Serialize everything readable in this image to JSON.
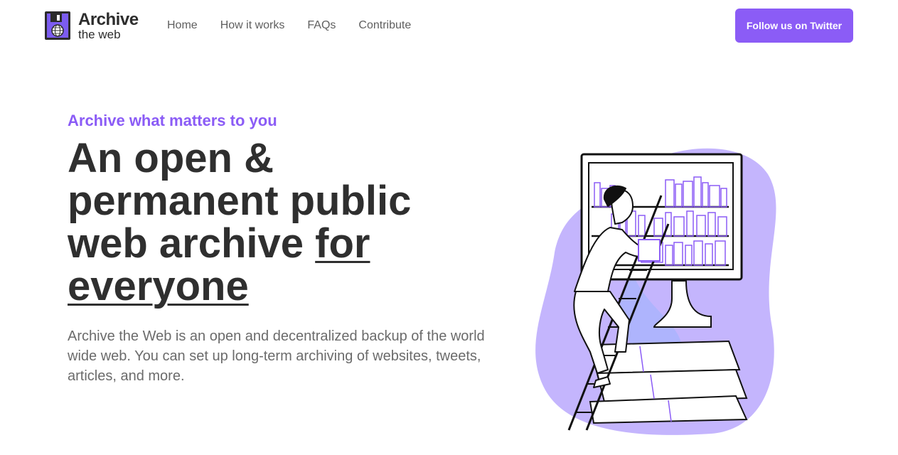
{
  "header": {
    "logo": {
      "title": "Archive",
      "subtitle": "the web",
      "icon": "floppy-disk-globe-icon"
    },
    "nav": [
      {
        "label": "Home"
      },
      {
        "label": "How it works"
      },
      {
        "label": "FAQs"
      },
      {
        "label": "Contribute"
      }
    ],
    "cta_label": "Follow us on Twitter"
  },
  "hero": {
    "kicker": "Archive what matters to you",
    "headline_plain": "An open & permanent public web archive ",
    "headline_underlined": "for everyone",
    "lead": "Archive the Web is an open and decentralized backup of the world wide web. You can set up long-term archiving of websites, tweets, articles, and more.",
    "illustration": "person-climbing-ladder-to-bookshelf-monitor-illustration"
  },
  "colors": {
    "accent": "#8b5cf6",
    "heading": "#2f2f2f",
    "body_text": "#6b6b6b",
    "nav_text": "#5f5f5f",
    "blob": "#c4b5fd"
  }
}
